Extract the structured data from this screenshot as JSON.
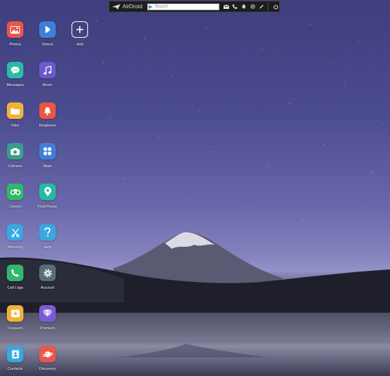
{
  "topbar": {
    "brand": "AirDroid",
    "search_placeholder": "Search",
    "icons": [
      "mail-icon",
      "phone-icon",
      "bell-icon",
      "gear-icon",
      "pen-icon",
      "power-icon"
    ]
  },
  "apps": {
    "photos": {
      "label": "Photos",
      "color": "#e8584a"
    },
    "videos": {
      "label": "Videos",
      "color": "#3f7fd8"
    },
    "add": {
      "label": "Add"
    },
    "messages": {
      "label": "Messages",
      "color": "#2bb9a8"
    },
    "music": {
      "label": "Music",
      "color": "#6a5acd"
    },
    "files": {
      "label": "Files",
      "color": "#f2b233"
    },
    "ringtones": {
      "label": "Ringtones",
      "color": "#e85646"
    },
    "camera": {
      "label": "Camera",
      "color": "#3a9d8c"
    },
    "apps": {
      "label": "Apps",
      "color": "#3f7fd8"
    },
    "control": {
      "label": "Control",
      "color": "#31b86a"
    },
    "find_phone": {
      "label": "Find Phone",
      "color": "#27b9a4"
    },
    "mirroring": {
      "label": "Mirroring",
      "color": "#3aa7e0"
    },
    "help": {
      "label": "Help",
      "color": "#3aa7e0"
    },
    "call_logs": {
      "label": "Call Logs",
      "color": "#31b86a"
    },
    "account": {
      "label": "Account",
      "color": "#5a6b7a"
    },
    "frequent": {
      "label": "Frequent",
      "color": "#f2b233"
    },
    "premium": {
      "label": "Premium",
      "color": "#7e5ad8"
    },
    "contacts": {
      "label": "Contacts",
      "color": "#3aa7e0"
    },
    "discovery": {
      "label": "Discovery",
      "color": "#e8584a"
    }
  }
}
